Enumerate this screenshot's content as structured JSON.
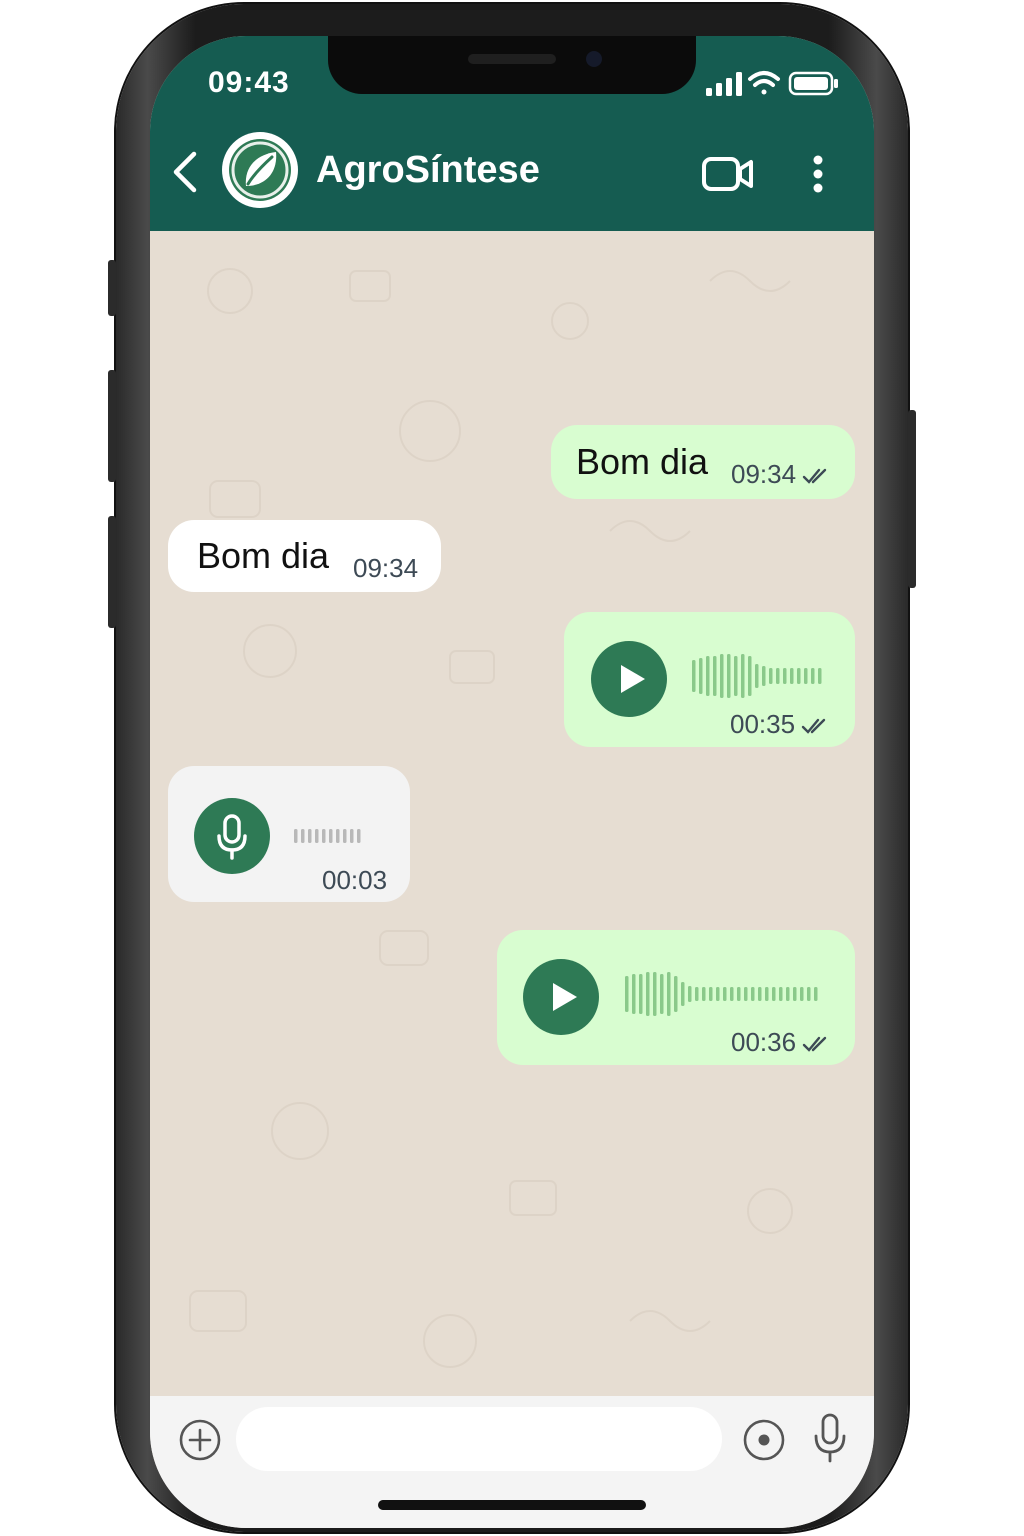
{
  "status_bar": {
    "time": "09:43"
  },
  "header": {
    "title": "AgroSíntese",
    "avatar_icon": "leaf-icon"
  },
  "messages": [
    {
      "type": "text",
      "direction": "outgoing",
      "text": "Bom dia",
      "time": "09:34",
      "read": true
    },
    {
      "type": "text",
      "direction": "incoming",
      "text": "Bom dia",
      "time": "09:34"
    },
    {
      "type": "voice",
      "direction": "outgoing",
      "duration": "00:35",
      "read": true
    },
    {
      "type": "voice",
      "direction": "incoming",
      "duration": "00:03"
    },
    {
      "type": "voice",
      "direction": "outgoing",
      "duration": "00:36",
      "read": true
    }
  ],
  "input": {
    "placeholder": ""
  },
  "colors": {
    "header": "#155c51",
    "chat_background": "#e6ddd2",
    "outgoing_bubble": "#d8fdd0",
    "incoming_bubble": "#ffffff",
    "play_button": "#2e7a55"
  }
}
